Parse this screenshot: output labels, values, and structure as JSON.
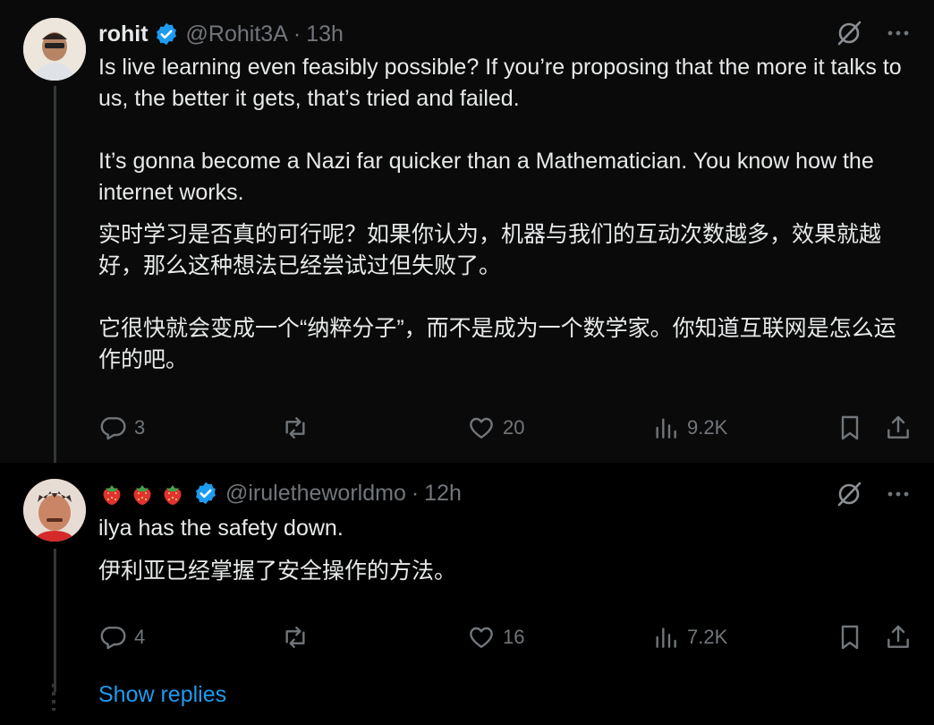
{
  "posts": [
    {
      "display_name": "rohit",
      "handle": "@Rohit3A",
      "time": "13h",
      "text_en_1": "Is live learning even feasibly possible? If you’re proposing that the more it talks to us, the better it gets, that’s tried and failed.",
      "text_en_2": "It’s gonna become a Nazi far quicker than a Mathematician. You know how the internet works.",
      "text_zh_1": "实时学习是否真的可行呢？如果你认为，机器与我们的互动次数越多，效果就越好，那么这种想法已经尝试过但失败了。",
      "text_zh_2": "它很快就会变成一个“纳粹分子”，而不是成为一个数学家。你知道互联网是怎么运作的吧。",
      "replies": "3",
      "reposts": "",
      "likes": "20",
      "views": "9.2K"
    },
    {
      "display_name_emoji": "🍓🍓🍓",
      "handle": "@iruletheworldmo",
      "time": "12h",
      "text_en_1": "ilya has the safety down.",
      "text_zh_1": "伊利亚已经掌握了安全操作的方法。",
      "replies": "4",
      "reposts": "",
      "likes": "16",
      "views": "7.2K"
    }
  ],
  "show_replies": "Show replies",
  "colors": {
    "background": "#000000",
    "text": "#e7e9ea",
    "muted": "#71767b",
    "link": "#1d9bf0",
    "verified": "#1d9bf0"
  },
  "icons": [
    "verified-badge-icon",
    "grok-icon",
    "more-icon",
    "reply-icon",
    "repost-icon",
    "like-icon",
    "views-icon",
    "bookmark-icon",
    "share-icon"
  ]
}
